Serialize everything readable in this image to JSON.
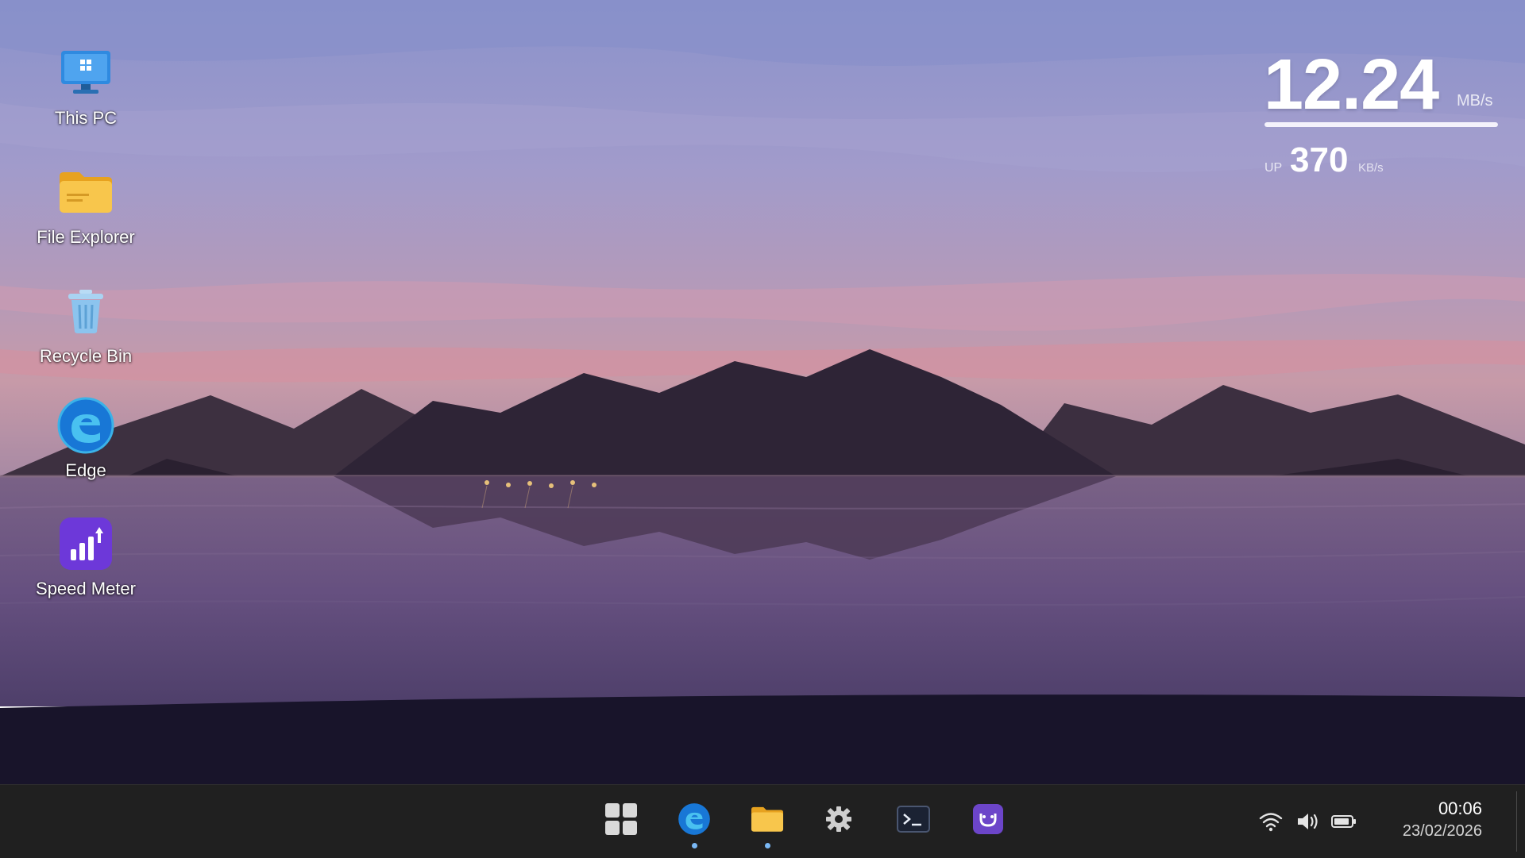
{
  "desktop": {
    "icons": [
      {
        "label": "This PC",
        "icon": "monitor-icon"
      },
      {
        "label": "File Explorer",
        "icon": "folder-icon"
      },
      {
        "label": "Recycle Bin",
        "icon": "recycle-bin-icon"
      },
      {
        "label": "Edge",
        "icon": "edge-icon"
      },
      {
        "label": "Speed Meter",
        "icon": "speed-meter-icon"
      }
    ]
  },
  "speed_widget": {
    "download_value": "12.24",
    "download_unit": "MB/s",
    "upload_label": "UP",
    "upload_value": "370",
    "upload_unit": "KB/s"
  },
  "taskbar": {
    "apps": [
      {
        "name": "start",
        "icon": "windows-start-icon",
        "running": false
      },
      {
        "name": "edge",
        "icon": "edge-icon",
        "running": true
      },
      {
        "name": "file-explorer",
        "icon": "folder-icon",
        "running": true
      },
      {
        "name": "settings",
        "icon": "gear-icon",
        "running": false
      },
      {
        "name": "terminal",
        "icon": "terminal-icon",
        "running": false
      },
      {
        "name": "speed-meter",
        "icon": "speed-meter-icon",
        "running": false
      }
    ],
    "tray": [
      "wifi-icon",
      "volume-icon",
      "battery-icon"
    ],
    "clock": {
      "time": "00:06",
      "date": "23/02/2026"
    }
  },
  "colors": {
    "taskbar_bg": "#202020",
    "running_indicator": "#7ab8f5",
    "sky_top": "#8b93cc",
    "sky_horizon": "#c79aa8",
    "mountain": "#2e2436",
    "water": "#6a5478"
  }
}
